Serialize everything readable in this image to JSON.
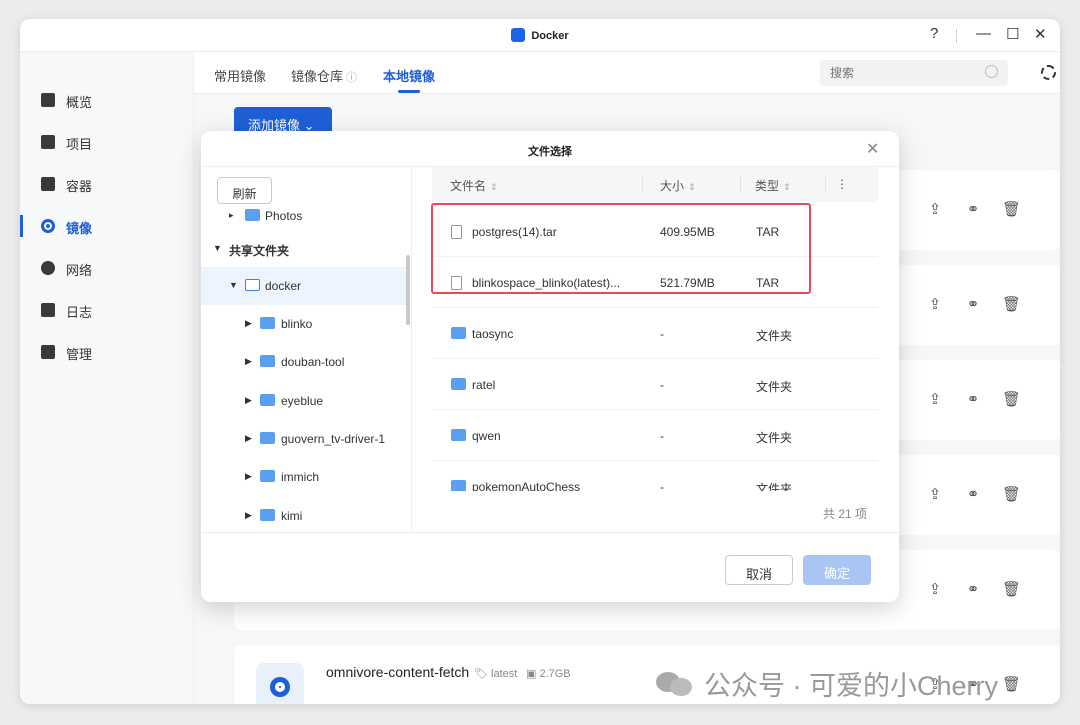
{
  "window": {
    "title": "Docker"
  },
  "sidebar": {
    "items": [
      {
        "label": "概览"
      },
      {
        "label": "项目"
      },
      {
        "label": "容器"
      },
      {
        "label": "镜像"
      },
      {
        "label": "网络"
      },
      {
        "label": "日志"
      },
      {
        "label": "管理"
      }
    ]
  },
  "tabs": [
    {
      "label": "常用镜像"
    },
    {
      "label": "镜像仓库"
    },
    {
      "label": "本地镜像"
    }
  ],
  "search": {
    "placeholder": "搜索"
  },
  "toolbar": {
    "add_label": "添加镜像"
  },
  "omnivore": {
    "name": "omnivore-content-fetch",
    "tag": "latest",
    "size": "2.7GB"
  },
  "dialog": {
    "title": "文件选择",
    "refresh_label": "刷新",
    "tree": {
      "partial_item": "Photos",
      "shared_folder": "共享文件夹",
      "selected": "docker",
      "children": [
        {
          "name": "blinko"
        },
        {
          "name": "douban-tool"
        },
        {
          "name": "eyeblue"
        },
        {
          "name": "guovern_tv-driver-1"
        },
        {
          "name": "immich"
        },
        {
          "name": "kimi"
        }
      ]
    },
    "columns": {
      "name": "文件名",
      "size": "大小",
      "type": "类型"
    },
    "files": [
      {
        "name": "postgres(14).tar",
        "size": "409.95MB",
        "type": "TAR"
      },
      {
        "name": "blinkospace_blinko(latest)...",
        "size": "521.79MB",
        "type": "TAR"
      },
      {
        "name": "taosync",
        "size": "-",
        "type": "文件夹"
      },
      {
        "name": "ratel",
        "size": "-",
        "type": "文件夹"
      },
      {
        "name": "qwen",
        "size": "-",
        "type": "文件夹"
      },
      {
        "name": "pokemonAutoChess",
        "size": "-",
        "type": "文件夹"
      }
    ],
    "total": "共 21 项",
    "cancel_label": "取消",
    "ok_label": "确定"
  },
  "watermark": "公众号 · 可爱的小Cherry"
}
